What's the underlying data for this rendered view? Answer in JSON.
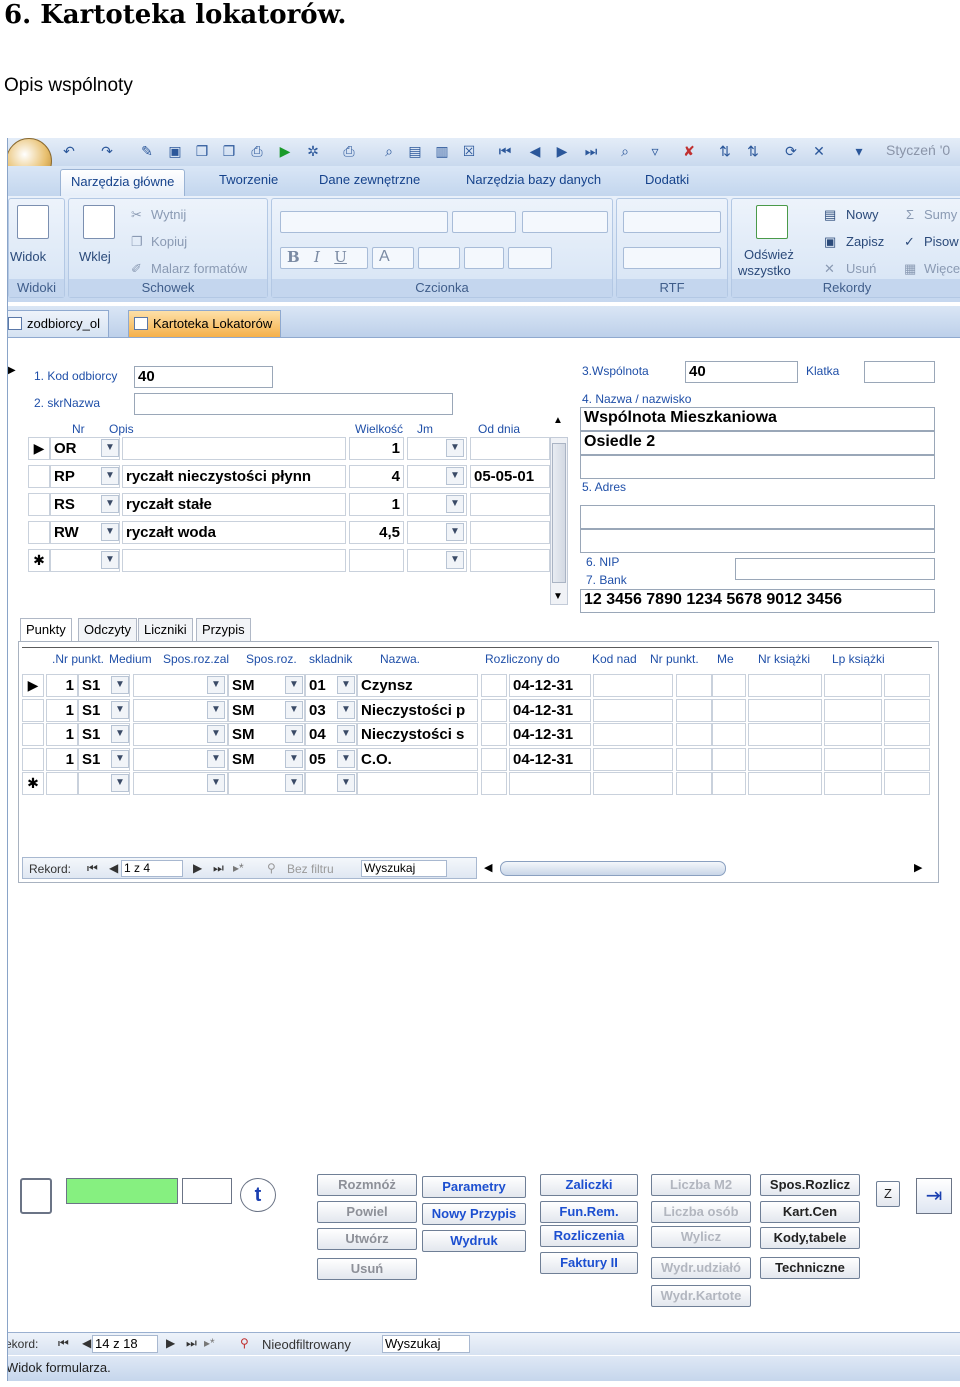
{
  "document": {
    "heading": "6. Kartoteka lokatorów.",
    "subheading": "Opis wspólnoty"
  },
  "quick_access": {
    "month": "Styczeń '0"
  },
  "ribbon": {
    "tabs": [
      "Narzędzia główne",
      "Tworzenie",
      "Dane zewnętrzne",
      "Narzędzia bazy danych",
      "Dodatki"
    ],
    "views": {
      "button": "Widok",
      "group": "Widoki"
    },
    "clipboard": {
      "paste": "Wklej",
      "cut": "Wytnij",
      "copy": "Kopiuj",
      "format_painter": "Malarz formatów",
      "group": "Schowek"
    },
    "font": {
      "group": "Czcionka",
      "bold": "B",
      "italic": "I",
      "underline": "U",
      "color": "A"
    },
    "rtf": {
      "group": "RTF"
    },
    "records": {
      "refresh_line1": "Odśwież",
      "refresh_line2": "wszystko",
      "new": "Nowy",
      "save": "Zapisz",
      "delete": "Usuń",
      "totals": "Sumy",
      "spelling": "Pisow",
      "more": "Więce",
      "group": "Rekordy"
    }
  },
  "doc_tabs": [
    "zodbiorcy_ol",
    "Kartoteka Lokatorów"
  ],
  "form": {
    "labels": {
      "kod": "1. Kod odbiorcy",
      "skr": "2. skrNazwa",
      "wspolnota": "3.Wspólnota",
      "klatka": "Klatka",
      "nazwa": "4. Nazwa / nazwisko",
      "adres": "5. Adres",
      "nip": "6. NIP",
      "bank": "7. Bank"
    },
    "values": {
      "kod": "40",
      "wspolnota": "40",
      "nazwa_1": "Wspólnota Mieszkaniowa",
      "nazwa_2": "Osiedle 2",
      "bank": "12 3456 7890 1234 5678 9012 3456"
    },
    "charges": {
      "headers": {
        "nr": "Nr",
        "opis": "Opis",
        "wielkosc": "Wielkość",
        "jm": "Jm",
        "od_dnia": "Od dnia"
      },
      "rows": [
        {
          "nr": "OR",
          "opis": "",
          "wielkosc": "1",
          "od": ""
        },
        {
          "nr": "RP",
          "opis": "ryczałt nieczystości płynn",
          "wielkosc": "4",
          "od": "05-05-01"
        },
        {
          "nr": "RS",
          "opis": "ryczałt stałe",
          "wielkosc": "1",
          "od": ""
        },
        {
          "nr": "RW",
          "opis": "ryczałt woda",
          "wielkosc": "4,5",
          "od": ""
        }
      ]
    },
    "subtabs": [
      "Punkty",
      "Odczyty",
      "Liczniki",
      "Przypis"
    ],
    "points": {
      "headers": {
        "nr": ".Nr punkt.",
        "medium": "Medium",
        "spos_zal": "Spos.roz.zal",
        "spos": "Spos.roz.",
        "skladnik": "skladnik",
        "nazwa": "Nazwa.",
        "rozliczony": "Rozliczony do",
        "kod_nad": "Kod nad",
        "nr_punkt": "Nr punkt.",
        "me": "Me",
        "nr_ksiazki": "Nr książki",
        "lp_ksiazki": "Lp książki"
      },
      "rows": [
        {
          "nr": "1",
          "medium": "S1",
          "spos": "SM",
          "skladnik": "01",
          "nazwa": "Czynsz",
          "rozliczony": "04-12-31"
        },
        {
          "nr": "1",
          "medium": "S1",
          "spos": "SM",
          "skladnik": "03",
          "nazwa": "Nieczystości p",
          "rozliczony": "04-12-31"
        },
        {
          "nr": "1",
          "medium": "S1",
          "spos": "SM",
          "skladnik": "04",
          "nazwa": "Nieczystości s",
          "rozliczony": "04-12-31"
        },
        {
          "nr": "1",
          "medium": "S1",
          "spos": "SM",
          "skladnik": "05",
          "nazwa": "C.O.",
          "rozliczony": "04-12-31"
        }
      ],
      "nav": {
        "label": "Rekord:",
        "position": "1 z 4",
        "filter": "Bez filtru",
        "search": "Wyszukaj"
      }
    }
  },
  "buttons": {
    "col1": [
      "Rozmnóż",
      "Powiel",
      "Utwórz",
      "Usuń"
    ],
    "col2": [
      "Parametry",
      "Nowy Przypis",
      "Wydruk"
    ],
    "col3": [
      "Zaliczki",
      "Fun.Rem.",
      "Rozliczenia",
      "Faktury II"
    ],
    "col4": [
      "Liczba M2",
      "Liczba osób",
      "Wylicz",
      "Wydr.udziałó",
      "Wydr.Kartote"
    ],
    "col5": [
      "Spos.Rozlicz",
      "Kart.Cen",
      "Kody,tabele",
      "Techniczne"
    ],
    "z": "Z",
    "t": "t"
  },
  "status": {
    "record_label": "ekord:",
    "position": "14 z 18",
    "filter": "Nieodfiltrowany",
    "search": "Wyszukaj",
    "view": "Widok formularza."
  },
  "colors": {
    "link_label": "#1f4fa8",
    "ribbon_text": "#15428b",
    "green_field": "#86f080",
    "active_tab": "#f5b04a"
  }
}
